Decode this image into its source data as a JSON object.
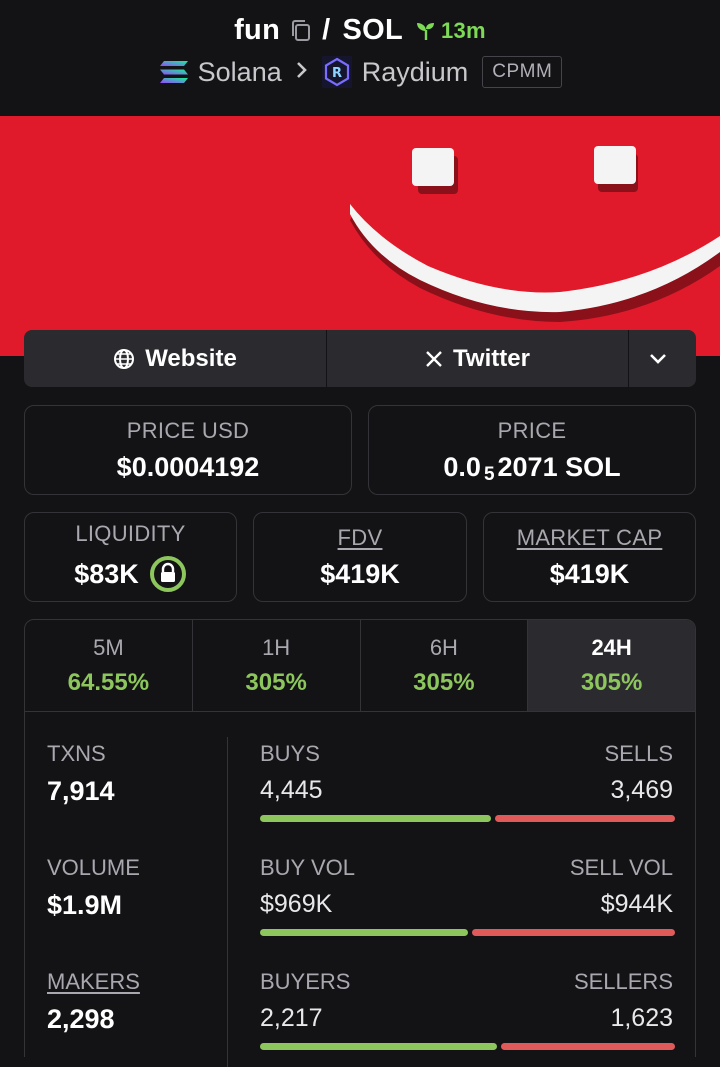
{
  "header": {
    "token": "fun",
    "pair_separator": "/",
    "quote": "SOL",
    "age": "13m",
    "chain": "Solana",
    "dex": "Raydium",
    "pool_type": "CPMM"
  },
  "links": {
    "website": "Website",
    "twitter": "Twitter"
  },
  "metrics": {
    "price_usd_label": "PRICE USD",
    "price_usd": "$0.0004192",
    "price_label": "PRICE",
    "price_prefix": "0.0",
    "price_sub": "5",
    "price_rest": "2071 SOL",
    "liquidity_label": "LIQUIDITY",
    "liquidity": "$83K",
    "fdv_label": "FDV",
    "fdv": "$419K",
    "mcap_label": "MARKET CAP",
    "mcap": "$419K"
  },
  "periods": [
    {
      "label": "5M",
      "change": "64.55%"
    },
    {
      "label": "1H",
      "change": "305%"
    },
    {
      "label": "6H",
      "change": "305%"
    },
    {
      "label": "24H",
      "change": "305%"
    }
  ],
  "stats": {
    "txns_label": "TXNS",
    "txns": "7,914",
    "volume_label": "VOLUME",
    "volume": "$1.9M",
    "makers_label": "MAKERS",
    "makers": "2,298",
    "buys_label": "BUYS",
    "buys": "4,445",
    "sells_label": "SELLS",
    "sells": "3,469",
    "buy_vol_label": "BUY VOL",
    "buy_vol": "$969K",
    "sell_vol_label": "SELL VOL",
    "sell_vol": "$944K",
    "buyers_label": "BUYERS",
    "buyers": "2,217",
    "sellers_label": "SELLERS",
    "sellers": "1,623",
    "buys_share": 0.562,
    "buy_vol_share": 0.507,
    "buyers_share": 0.577
  },
  "colors": {
    "up": "#8cc65c",
    "down": "#e05a5a",
    "banner": "#e01a2a"
  },
  "icons": [
    "copy-icon",
    "sprout-icon",
    "solana-icon",
    "chevron-right-icon",
    "raydium-icon",
    "globe-icon",
    "x-icon",
    "chevron-down-icon",
    "lock-icon"
  ]
}
